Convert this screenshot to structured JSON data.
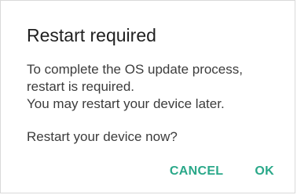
{
  "dialog": {
    "title": "Restart required",
    "message_lines": [
      "To complete the OS update process,",
      "restart is required.",
      "You may restart your device later."
    ],
    "question": "Restart your device now?",
    "cancel_label": "CANCEL",
    "ok_label": "OK"
  },
  "colors": {
    "accent": "#2aa889",
    "title_text": "#212121",
    "body_text": "#3c3c3c",
    "background": "#ffffff"
  }
}
